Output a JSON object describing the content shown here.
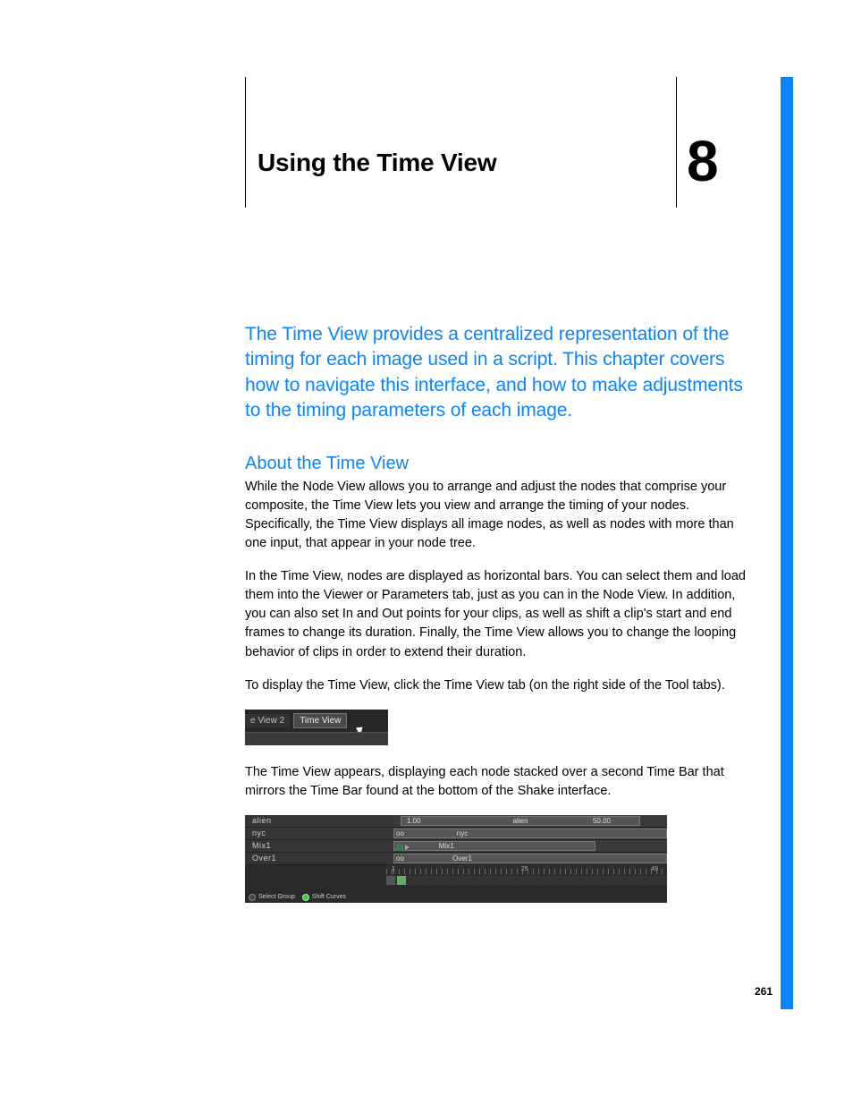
{
  "chapter": {
    "title": "Using the Time View",
    "number": "8"
  },
  "intro": "The Time View provides a centralized representation of the timing for each image used in a script. This chapter covers how to navigate this interface, and how to make adjustments to the timing parameters of each image.",
  "section_heading": "About the Time View",
  "para1": "While the Node View allows you to arrange and adjust the nodes that comprise your composite, the Time View lets you view and arrange the timing of your nodes. Specifically, the Time View displays all image nodes, as well as nodes with more than one input, that appear in your node tree.",
  "para2": "In the Time View, nodes are displayed as horizontal bars. You can select them and load them into the Viewer or Parameters tab, just as you can in the Node View. In addition, you can also set In and Out points for your clips, as well as shift a clip's start and end frames to change its duration. Finally, the Time View allows you to change the looping behavior of clips in order to extend their duration.",
  "para3": "To display the Time View, click the Time View tab (on the right side of the Tool tabs).",
  "para4": "The Time View appears, displaying each node stacked over a second Time Bar that mirrors the Time Bar found at the bottom of the Shake interface.",
  "tabs": {
    "inactive": "e View 2",
    "active": "Time View"
  },
  "timeview": {
    "rows": [
      {
        "label": "alien",
        "start_num": "1.00",
        "bar_text": "alien",
        "end_num": "50.00"
      },
      {
        "label": "nyc",
        "inf": "oo",
        "bar_text": "nyc"
      },
      {
        "label": "Mix1",
        "bar_text": "Mix1",
        "has_icons": true
      },
      {
        "label": "Over1",
        "inf": "oo",
        "bar_text": "Over1"
      }
    ],
    "ruler": [
      "1",
      "25",
      "49"
    ],
    "footer": {
      "opt1": "Select Group",
      "opt2": "Shift Curves"
    }
  },
  "page_number": "261"
}
